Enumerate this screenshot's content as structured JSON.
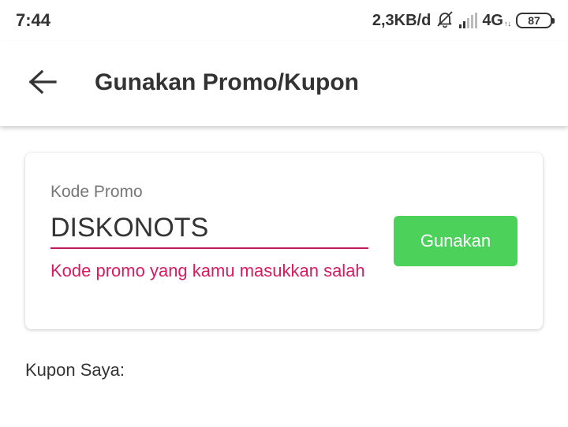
{
  "status_bar": {
    "time": "7:44",
    "speed": "2,3KB/d",
    "network": "4G",
    "network_sub": "↑↓",
    "battery": "87",
    "icons": [
      "bell-muted-icon",
      "signal-icon",
      "battery-icon"
    ]
  },
  "app_bar": {
    "back_icon": "arrow-left-icon",
    "title": "Gunakan Promo/Kupon"
  },
  "promo": {
    "label": "Kode Promo",
    "value": "DISKONOTS",
    "error": "Kode promo yang kamu masukkan salah",
    "button_label": "Gunakan"
  },
  "coupons": {
    "title": "Kupon Saya:"
  },
  "colors": {
    "error": "#d81b60",
    "button": "#4cd15b",
    "text": "#333333"
  }
}
